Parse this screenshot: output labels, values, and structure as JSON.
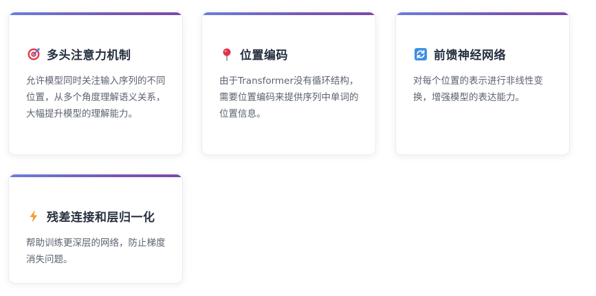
{
  "cards": [
    {
      "icon": "target-icon",
      "title": "多头注意力机制",
      "description": "允许模型同时关注输入序列的不同位置，从多个角度理解语义关系，大幅提升模型的理解能力。"
    },
    {
      "icon": "pushpin-icon",
      "title": "位置编码",
      "description": "由于Transformer没有循环结构，需要位置编码来提供序列中单词的位置信息。"
    },
    {
      "icon": "refresh-icon",
      "title": "前馈神经网络",
      "description": "对每个位置的表示进行非线性变换，增强模型的表达能力。"
    },
    {
      "icon": "lightning-icon",
      "title": "残差连接和层归一化",
      "description": "帮助训练更深层的网络，防止梯度消失问题。"
    }
  ],
  "colors": {
    "accent_gradient_start": "#6a7de0",
    "accent_gradient_end": "#7a4aa6",
    "title": "#262f3f",
    "body_text": "#5b6270"
  }
}
